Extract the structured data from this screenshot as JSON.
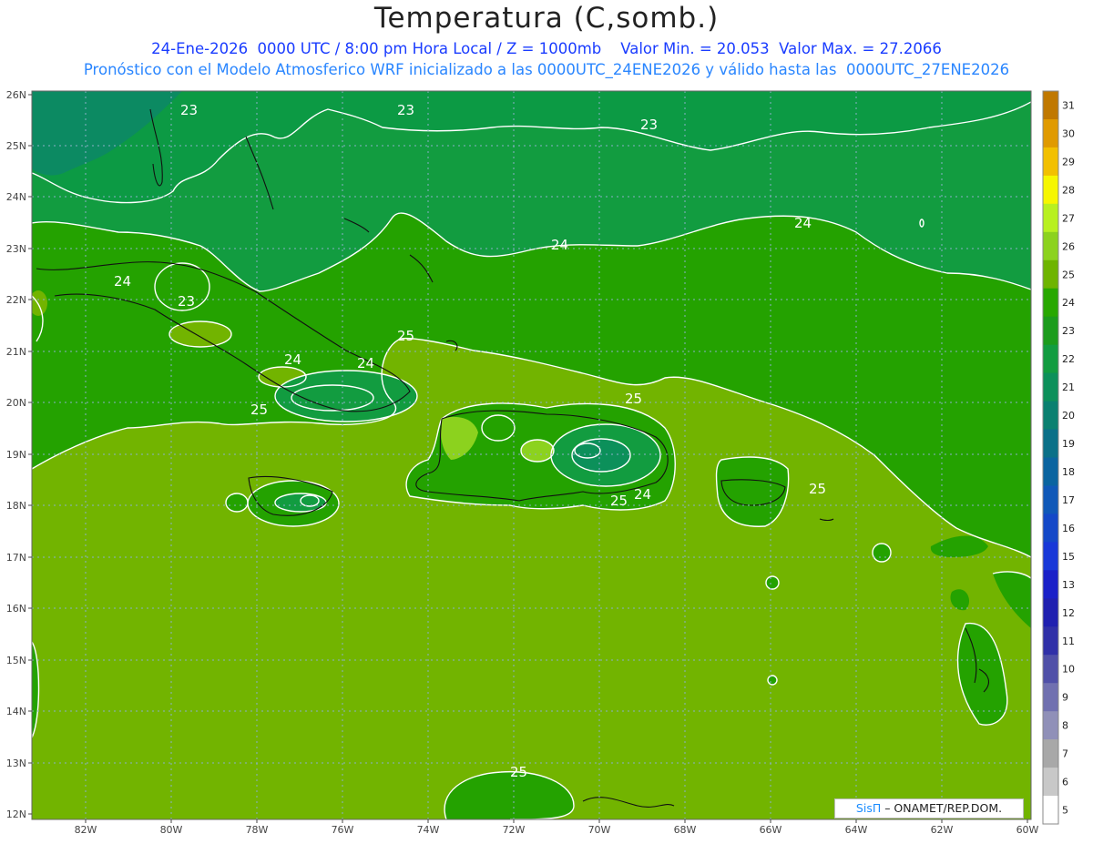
{
  "header": {
    "title": "Temperatura (C,somb.)",
    "line1": "24-Ene-2026  0000 UTC / 8:00 pm Hora Local / Z = 1000mb    Valor Min. = 20.053  Valor Max. = 27.2066",
    "line2": "Pronóstico con el Modelo Atmosferico WRF inicializado a las 0000UTC_24ENE2026 y válido hasta las  0000UTC_27ENE2026"
  },
  "credit": {
    "brand": "SisΠ",
    "text": " – ONAMET/REP.DOM."
  },
  "axes": {
    "lat_labels": [
      "26N",
      "25N",
      "24N",
      "23N",
      "22N",
      "21N",
      "20N",
      "19N",
      "18N",
      "17N",
      "16N",
      "15N",
      "14N",
      "13N",
      "12N"
    ],
    "lon_labels": [
      "82W",
      "80W",
      "78W",
      "76W",
      "74W",
      "72W",
      "70W",
      "68W",
      "66W",
      "64W",
      "62W",
      "60W"
    ]
  },
  "colorbar": {
    "labels": [
      "31",
      "30",
      "29",
      "28",
      "27",
      "26",
      "25",
      "24",
      "23",
      "22",
      "21",
      "20",
      "19",
      "18",
      "17",
      "16",
      "15",
      "13",
      "12",
      "11",
      "10",
      "9",
      "8",
      "7",
      "6",
      "5"
    ],
    "colors": [
      "#c07800",
      "#e09a00",
      "#f2c000",
      "#f6f600",
      "#b8f020",
      "#8cd21e",
      "#6eb400",
      "#28a800",
      "#1c9c1c",
      "#129c40",
      "#0c905a",
      "#0a8070",
      "#0a7088",
      "#0a64a0",
      "#1058b8",
      "#1448c8",
      "#1838d8",
      "#1a20c8",
      "#2020b0",
      "#3030a8",
      "#5050a8",
      "#7070b0",
      "#9090b8",
      "#a8a8a8",
      "#c8c8c8",
      "#ffffff"
    ]
  },
  "contour_labels": [
    "23",
    "23",
    "23",
    "24",
    "24",
    "24",
    "24",
    "23",
    "25",
    "24",
    "25",
    "25",
    "25",
    "25",
    "24",
    "25"
  ],
  "colors": {
    "sea_green": "#72b400",
    "land_green": "#24a200",
    "north_dark": "#0c9a44",
    "far_nw": "#0c8a62"
  }
}
